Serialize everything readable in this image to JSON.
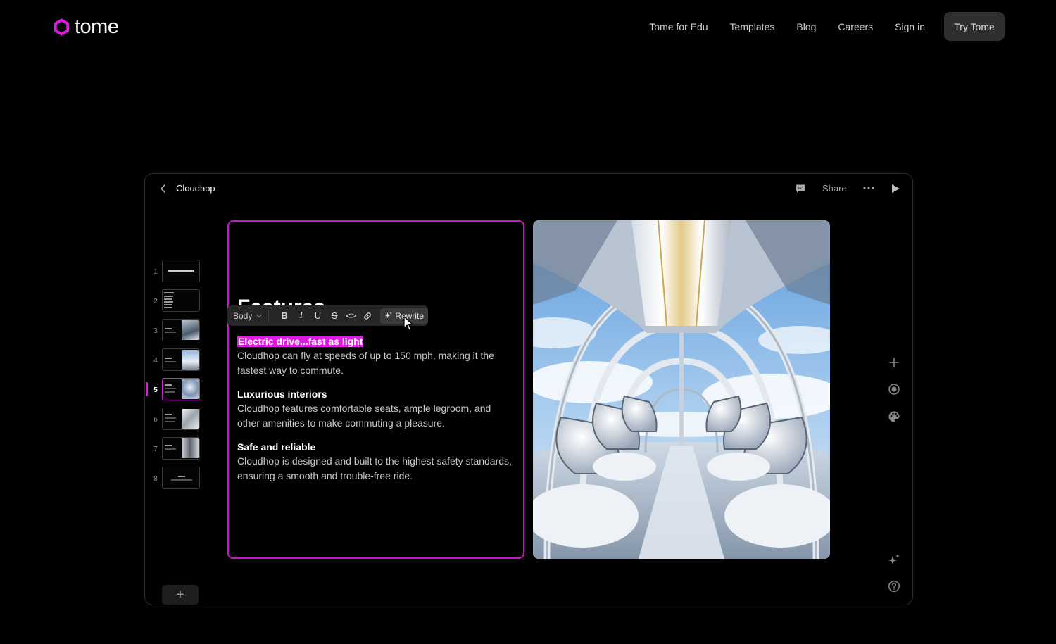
{
  "brand": {
    "name": "tome",
    "accent": "#e01ce0"
  },
  "nav": {
    "links": [
      "Tome for Edu",
      "Templates",
      "Blog",
      "Careers",
      "Sign in"
    ],
    "cta": "Try Tome"
  },
  "editor": {
    "doc_title": "Cloudhop",
    "share_label": "Share",
    "pages": [
      {
        "num": "1",
        "thumb": "Introducing Cloudhop"
      },
      {
        "num": "2",
        "thumb": "Problem Solution Features Benefits Pricing Funding"
      },
      {
        "num": "3",
        "thumb": ""
      },
      {
        "num": "4",
        "thumb": ""
      },
      {
        "num": "5",
        "thumb": ""
      },
      {
        "num": "6",
        "thumb": ""
      },
      {
        "num": "7",
        "thumb": ""
      },
      {
        "num": "8",
        "thumb": ""
      }
    ],
    "active_page": "5",
    "add_page_label": "+",
    "tile": {
      "heading": "Features",
      "toolbar": {
        "style": "Body",
        "bold": "B",
        "italic": "I",
        "underline": "U",
        "strike": "S",
        "code": "<>",
        "rewrite": "Rewrite"
      },
      "blocks": [
        {
          "title": "Electric drive...fast as light",
          "body": "Cloudhop can fly at speeds of up to 150 mph, making it the fastest way to commute."
        },
        {
          "title": "Luxurious interiors",
          "body": "Cloudhop features comfortable seats, ample legroom, and other amenities to make commuting a pleasure."
        },
        {
          "title": "Safe and reliable",
          "body": "Cloudhop is designed and built to the highest safety standards, ensuring a smooth and trouble-free ride."
        }
      ]
    },
    "image_alt": "futuristic-pod-interior-image",
    "right_tools": [
      "plus-icon",
      "record-icon",
      "palette-icon",
      "sparkle-icon",
      "help-icon"
    ]
  }
}
